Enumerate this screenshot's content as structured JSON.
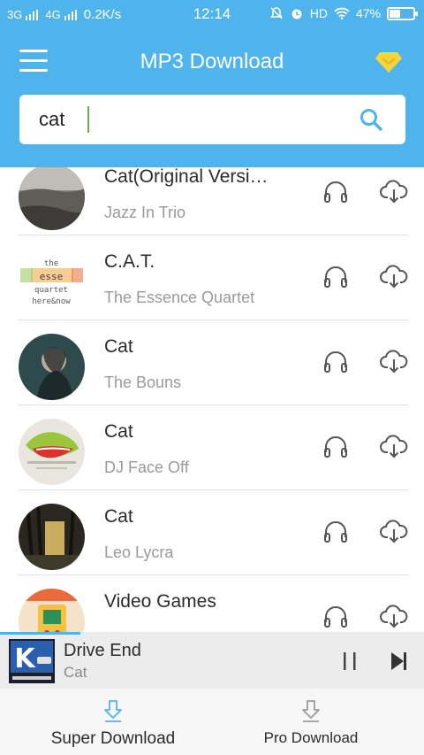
{
  "status_bar": {
    "network_1": "3G",
    "network_2": "4G",
    "speed": "0.2K/s",
    "time": "12:14",
    "hd": "HD",
    "battery": "47%",
    "battery_level": 0.47
  },
  "toolbar": {
    "title": "MP3 Download",
    "menu_icon": "hamburger-menu-icon",
    "vip_icon": "diamond-icon",
    "vip_color": "#f6d53a"
  },
  "search": {
    "value": "cat",
    "icon": "search-icon"
  },
  "songs": [
    {
      "title": "Cat(Original Versi…",
      "artist": "Jazz In Trio"
    },
    {
      "title": "C.A.T.",
      "artist": "The Essence Quartet",
      "cover_text": [
        "the",
        "esse",
        "quartet",
        "here&now"
      ]
    },
    {
      "title": "Cat",
      "artist": "The Bouns"
    },
    {
      "title": "Cat",
      "artist": "DJ Face Off"
    },
    {
      "title": "Cat",
      "artist": "Leo Lycra"
    },
    {
      "title": "Video Games",
      "artist": ""
    }
  ],
  "player": {
    "title": "Drive End",
    "artist": "Cat",
    "progress": 0.19,
    "cover_letter": "K"
  },
  "bottom_nav": {
    "super_label": "Super Download",
    "pro_label": "Pro Download"
  },
  "colors": {
    "accent": "#4fb4ec",
    "icon_gray": "#555555",
    "caret": "#6ab04c"
  }
}
